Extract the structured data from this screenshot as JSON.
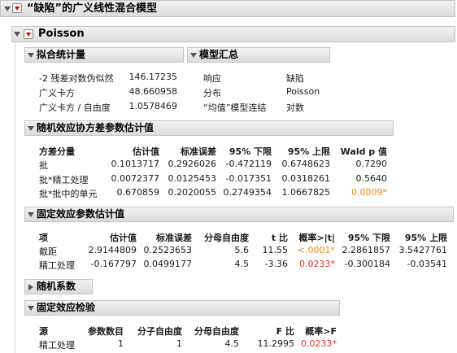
{
  "report_title": "“缺陷”的广义线性混合模型",
  "poisson_title": "Poisson",
  "fit_stats": {
    "title": "拟合统计量",
    "rows": [
      {
        "label": "-2 残差对数伪似然",
        "value": "146.17235"
      },
      {
        "label": "广义卡方",
        "value": "48.660958"
      },
      {
        "label": "广义卡方 / 自由度",
        "value": "1.0578469"
      }
    ]
  },
  "model_summary": {
    "title": "模型汇总",
    "rows": [
      {
        "label": "响应",
        "value": "缺陷"
      },
      {
        "label": "分布",
        "value": "Poisson"
      },
      {
        "label": "“均值”模型连结",
        "value": "对数"
      }
    ]
  },
  "random_cov": {
    "title": "随机效应协方差参数估计值",
    "columns": [
      "方差分量",
      "估计值",
      "标准误差",
      "95% 下限",
      "95% 上限",
      "Wald p 值"
    ],
    "rows": [
      [
        "批",
        "0.1013717",
        "0.2926026",
        "-0.472119",
        "0.6748623",
        "0.7290"
      ],
      [
        "批*精工处理",
        "0.0072377",
        "0.0125453",
        "-0.017351",
        "0.0318261",
        "0.5640"
      ],
      [
        "批*批中的单元",
        "0.670859",
        "0.2020055",
        "0.2749354",
        "1.0667825",
        "0.0009*"
      ]
    ]
  },
  "fixed_params": {
    "title": "固定效应参数估计值",
    "columns": [
      "项",
      "估计值",
      "标准误差",
      "分母自由度",
      "t 比",
      "概率>|t|",
      "95% 下限",
      "95% 上限"
    ],
    "rows": [
      [
        "截距",
        "2.9144809",
        "0.2523653",
        "5.6",
        "11.55",
        "<.0001*",
        "2.2861857",
        "3.5427761"
      ],
      [
        "精工处理",
        "-0.167797",
        "0.0499177",
        "4.5",
        "-3.36",
        "0.0233*",
        "-0.300184",
        "-0.03541"
      ]
    ]
  },
  "random_coef": {
    "title": "随机系数"
  },
  "fixed_tests": {
    "title": "固定效应检验",
    "columns": [
      "源",
      "参数数目",
      "分子自由度",
      "分母自由度",
      "F 比",
      "概率>F"
    ],
    "rows": [
      [
        "精工处理",
        "1",
        "1",
        "4.5",
        "11.2995",
        "0.0233*"
      ]
    ]
  },
  "colors": {
    "significant_red": "#e0302b",
    "significant_orange": "#ef8a22",
    "header_bg": "#e6e6e6"
  }
}
